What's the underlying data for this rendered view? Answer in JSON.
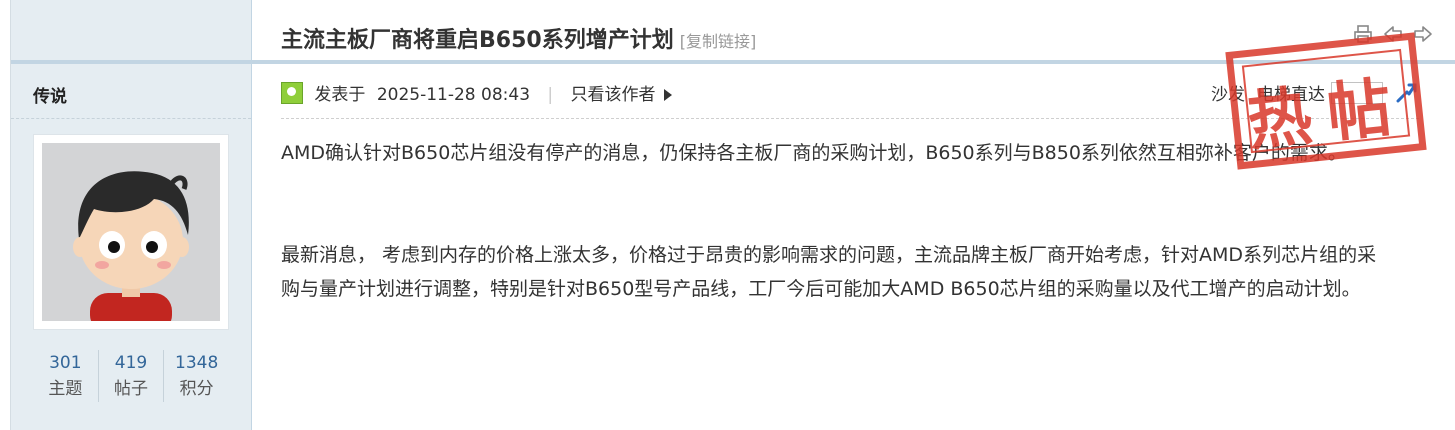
{
  "thread": {
    "title": "主流主板厂商将重启B650系列增产计划",
    "copy_link": "[复制链接]"
  },
  "author": {
    "name": "传说",
    "stats": [
      {
        "value": "301",
        "label": "主题"
      },
      {
        "value": "419",
        "label": "帖子"
      },
      {
        "value": "1348",
        "label": "积分"
      }
    ]
  },
  "post": {
    "posted_prefix": "发表于",
    "posted_time": "2025-11-28 08:43",
    "only_author": "只看该作者",
    "floor_label": "沙发",
    "jump_label": "电梯直达",
    "stamp": "热帖",
    "paragraphs": [
      "AMD确认针对B650芯片组没有停产的消息，仍保持各主板厂商的采购计划，B650系列与B850系列依然互相弥补客户的需求。",
      "最新消息， 考虑到内存的价格上涨太多，价格过于昂贵的影响需求的问题，主流品牌主板厂商开始考虑，针对AMD系列芯片组的采购与量产计划进行调整，特别是针对B650型号产品线，工厂今后可能加大AMD B650芯片组的采购量以及代工增产的启动计划。"
    ]
  },
  "icons": [
    "print-icon",
    "prev-thread-icon",
    "next-thread-icon",
    "post-status-icon",
    "go-icon"
  ],
  "colors": {
    "sidebar_bg": "#e5edf2",
    "stamp_red": "#d9382a",
    "stat_blue": "#336699"
  }
}
